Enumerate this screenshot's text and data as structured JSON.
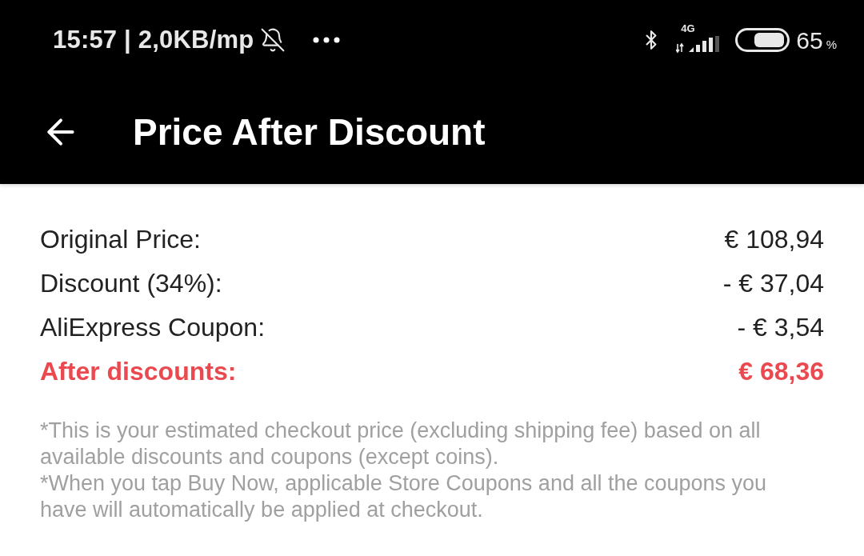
{
  "status_bar": {
    "time": "15:57 | 2,0KB/mp",
    "network_type": "4G",
    "battery": {
      "value": "65",
      "unit": "%"
    }
  },
  "header": {
    "title": "Price After Discount"
  },
  "price_rows": [
    {
      "kind": "normal",
      "label": "Original Price:",
      "amount": "€ 108,94"
    },
    {
      "kind": "normal",
      "label": "Discount (34%):",
      "amount": "- € 37,04"
    },
    {
      "kind": "normal",
      "label": "AliExpress Coupon:",
      "amount": "- € 3,54"
    },
    {
      "kind": "total",
      "label": "After discounts:",
      "amount": "€ 68,36"
    }
  ],
  "notes": [
    "*This is your estimated checkout price (excluding shipping fee) based on all available discounts and coupons (except coins).",
    "*When you tap Buy Now, applicable Store Coupons and all the coupons you have will automatically be applied at checkout."
  ]
}
